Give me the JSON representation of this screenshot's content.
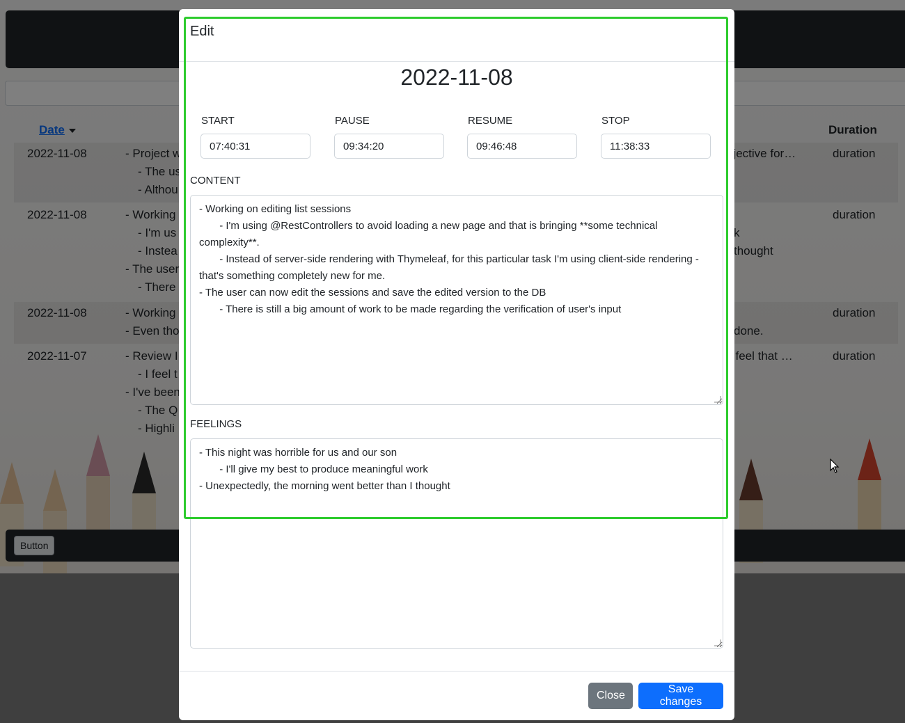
{
  "background": {
    "footer_button_label": "Button",
    "table": {
      "sort_header_label": "Date",
      "duration_header_label": "Duration",
      "rows": [
        {
          "date": "2022-11-08",
          "duration": "duration",
          "lines_left": [
            "- Project w",
            "- The us",
            "- Althou"
          ],
          "lines_right": [
            "bjective for…"
          ]
        },
        {
          "date": "2022-11-08",
          "duration": "duration",
          "lines_left": [
            "- Working",
            "- I'm us",
            "- Instea",
            "- The user",
            "- There"
          ],
          "lines_right": [
            "k",
            "thought"
          ]
        },
        {
          "date": "2022-11-08",
          "duration": "duration",
          "lines_left": [
            "- Working",
            "- Even tho"
          ],
          "lines_right": [
            "done."
          ]
        },
        {
          "date": "2022-11-07",
          "duration": "duration",
          "lines_left": [
            "- Review I",
            "- I feel t",
            "- I've been",
            "- The Q",
            "- Highli"
          ],
          "lines_right": [
            "l feel that …"
          ]
        }
      ]
    }
  },
  "modal": {
    "title": "Edit",
    "date": "2022-11-08",
    "times": {
      "start": {
        "label": "START",
        "value": "07:40:31"
      },
      "pause": {
        "label": "PAUSE",
        "value": "09:34:20"
      },
      "resume": {
        "label": "RESUME",
        "value": "09:46:48"
      },
      "stop": {
        "label": "STOP",
        "value": "11:38:33"
      }
    },
    "content": {
      "label": "CONTENT",
      "lines": [
        "- Working on editing list sessions",
        "       - I'm using @RestControllers to avoid loading a new page and that is bringing **some technical complexity**.",
        "       - Instead of server-side rendering with Thymeleaf, for this particular task I'm using client-side rendering - that's something completely new for me.",
        "- The user can now edit the sessions and save the edited version to the DB",
        "       - There is still a big amount of work to be made regarding the verification of user's input"
      ]
    },
    "feelings": {
      "label": "FEELINGS",
      "lines": [
        "- This night was horrible for us and our son",
        "       - I'll give my best to produce meaningful work",
        "- Unexpectedly, the morning went better than I thought"
      ]
    },
    "close_label": "Close",
    "save_label": "Save changes"
  },
  "colors": {
    "navbar": "#212529",
    "primary": "#0d6efd",
    "secondary": "#6c757d",
    "highlight": "#2ecc2e"
  }
}
